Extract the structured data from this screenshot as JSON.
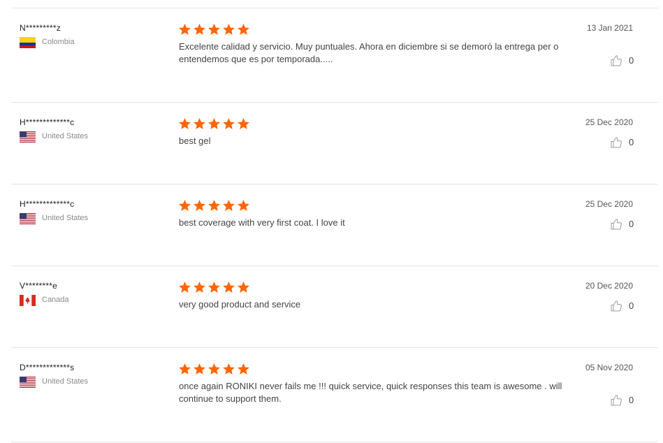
{
  "colors": {
    "star": "#ff6600",
    "divider": "#e6e6e6",
    "muted_text": "#8a8a8a"
  },
  "reviews": [
    {
      "user": "N*********z",
      "country": "Colombia",
      "flag_icon": "colombia-flag-icon",
      "rating": 5,
      "text": "Excelente calidad y servicio. Muy puntuales. Ahora en diciembre si se demoró la entrega per o entendemos que es por temporada.....",
      "date": "13 Jan 2021",
      "helpful_icon": "thumbs-up-icon",
      "helpful_count": "0"
    },
    {
      "user": "H*************c",
      "country": "United States",
      "flag_icon": "us-flag-icon",
      "rating": 5,
      "text": "best gel",
      "date": "25 Dec 2020",
      "helpful_icon": "thumbs-up-icon",
      "helpful_count": "0"
    },
    {
      "user": "H*************c",
      "country": "United States",
      "flag_icon": "us-flag-icon",
      "rating": 5,
      "text": "best coverage with very first coat. I love it",
      "date": "25 Dec 2020",
      "helpful_icon": "thumbs-up-icon",
      "helpful_count": "0"
    },
    {
      "user": "V********e",
      "country": "Canada",
      "flag_icon": "canada-flag-icon",
      "rating": 5,
      "text": "very good product and service",
      "date": "20 Dec 2020",
      "helpful_icon": "thumbs-up-icon",
      "helpful_count": "0"
    },
    {
      "user": "D*************s",
      "country": "United States",
      "flag_icon": "us-flag-icon",
      "rating": 5,
      "text": "once again RONIKI never fails me !!! quick service, quick responses this team is awesome . will continue to support them.",
      "date": "05 Nov 2020",
      "helpful_icon": "thumbs-up-icon",
      "helpful_count": "0"
    }
  ]
}
